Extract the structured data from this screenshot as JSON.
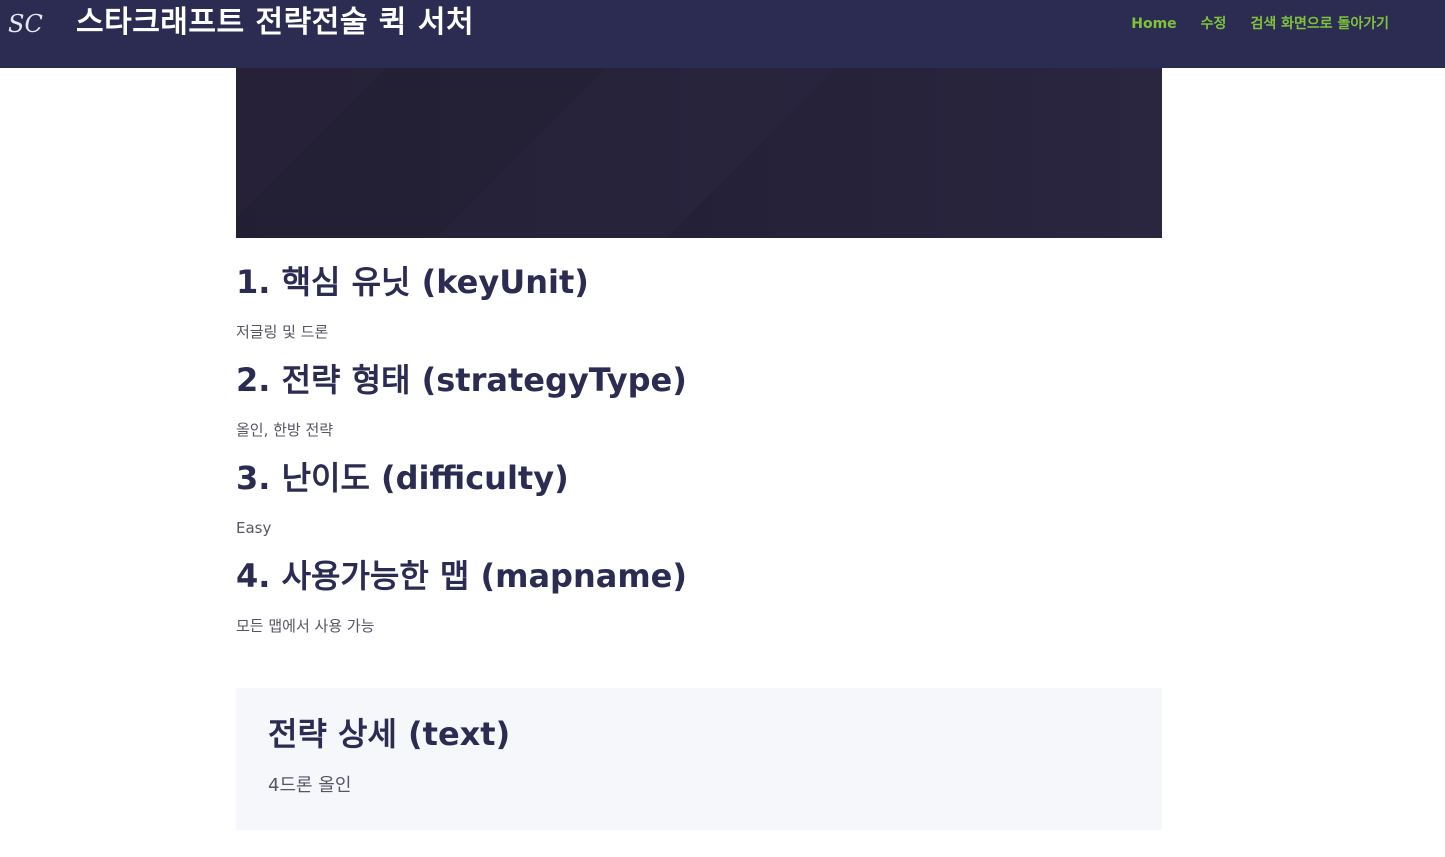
{
  "header": {
    "logo_text": "SC",
    "site_title": "스타크래프트 전략전술 퀵 서처",
    "nav": {
      "home": "Home",
      "edit": "수정",
      "back_to_search": "검색 화면으로 돌아가기"
    },
    "background_color": "#2c2b52",
    "nav_color": "#7fc33c"
  },
  "sections": {
    "key_unit": {
      "heading": "1. 핵심 유닛 (keyUnit)",
      "value": "저글링 및 드론"
    },
    "strategy_type": {
      "heading": "2. 전략 형태 (strategyType)",
      "value": "올인, 한방 전략"
    },
    "difficulty": {
      "heading": "3. 난이도 (difficulty)",
      "value": "Easy"
    },
    "mapname": {
      "heading": "4. 사용가능한 맵 (mapname)",
      "value": "모든 맵에서 사용 가능"
    }
  },
  "detail": {
    "title": "전략 상세 (text)",
    "text": "4드론 올인"
  }
}
